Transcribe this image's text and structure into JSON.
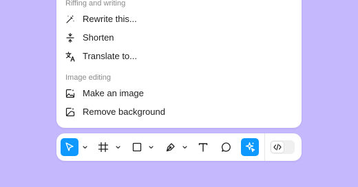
{
  "menu": {
    "sections": [
      {
        "heading": "Riffing and writing",
        "items": [
          {
            "label": "Rewrite this...",
            "icon": "magic-wand-icon"
          },
          {
            "label": "Shorten",
            "icon": "shorten-icon"
          },
          {
            "label": "Translate to...",
            "icon": "translate-icon"
          }
        ]
      },
      {
        "heading": "Image editing",
        "items": [
          {
            "label": "Make an image",
            "icon": "image-sparkle-icon"
          },
          {
            "label": "Remove background",
            "icon": "remove-background-icon"
          }
        ]
      }
    ]
  },
  "toolbar": {
    "tools": [
      {
        "name": "move-tool",
        "icon": "cursor-icon",
        "active": true,
        "has_dropdown": true
      },
      {
        "name": "frame-tool",
        "icon": "frame-icon",
        "active": false,
        "has_dropdown": true
      },
      {
        "name": "shape-tool",
        "icon": "rectangle-icon",
        "active": false,
        "has_dropdown": true
      },
      {
        "name": "pen-tool",
        "icon": "pen-icon",
        "active": false,
        "has_dropdown": true
      },
      {
        "name": "text-tool",
        "icon": "text-icon",
        "active": false,
        "has_dropdown": false
      },
      {
        "name": "comment-tool",
        "icon": "comment-icon",
        "active": false,
        "has_dropdown": false
      },
      {
        "name": "ai-tool",
        "icon": "sparkle-cursor-icon",
        "active": true,
        "has_dropdown": false
      }
    ],
    "dev_mode_toggle": {
      "icon": "code-icon",
      "on": false
    }
  },
  "colors": {
    "background": "#c6b8fd",
    "accent": "#0d99ff",
    "panel": "#ffffff",
    "text": "#1e1e1e",
    "muted_text": "#8a8a8a"
  }
}
